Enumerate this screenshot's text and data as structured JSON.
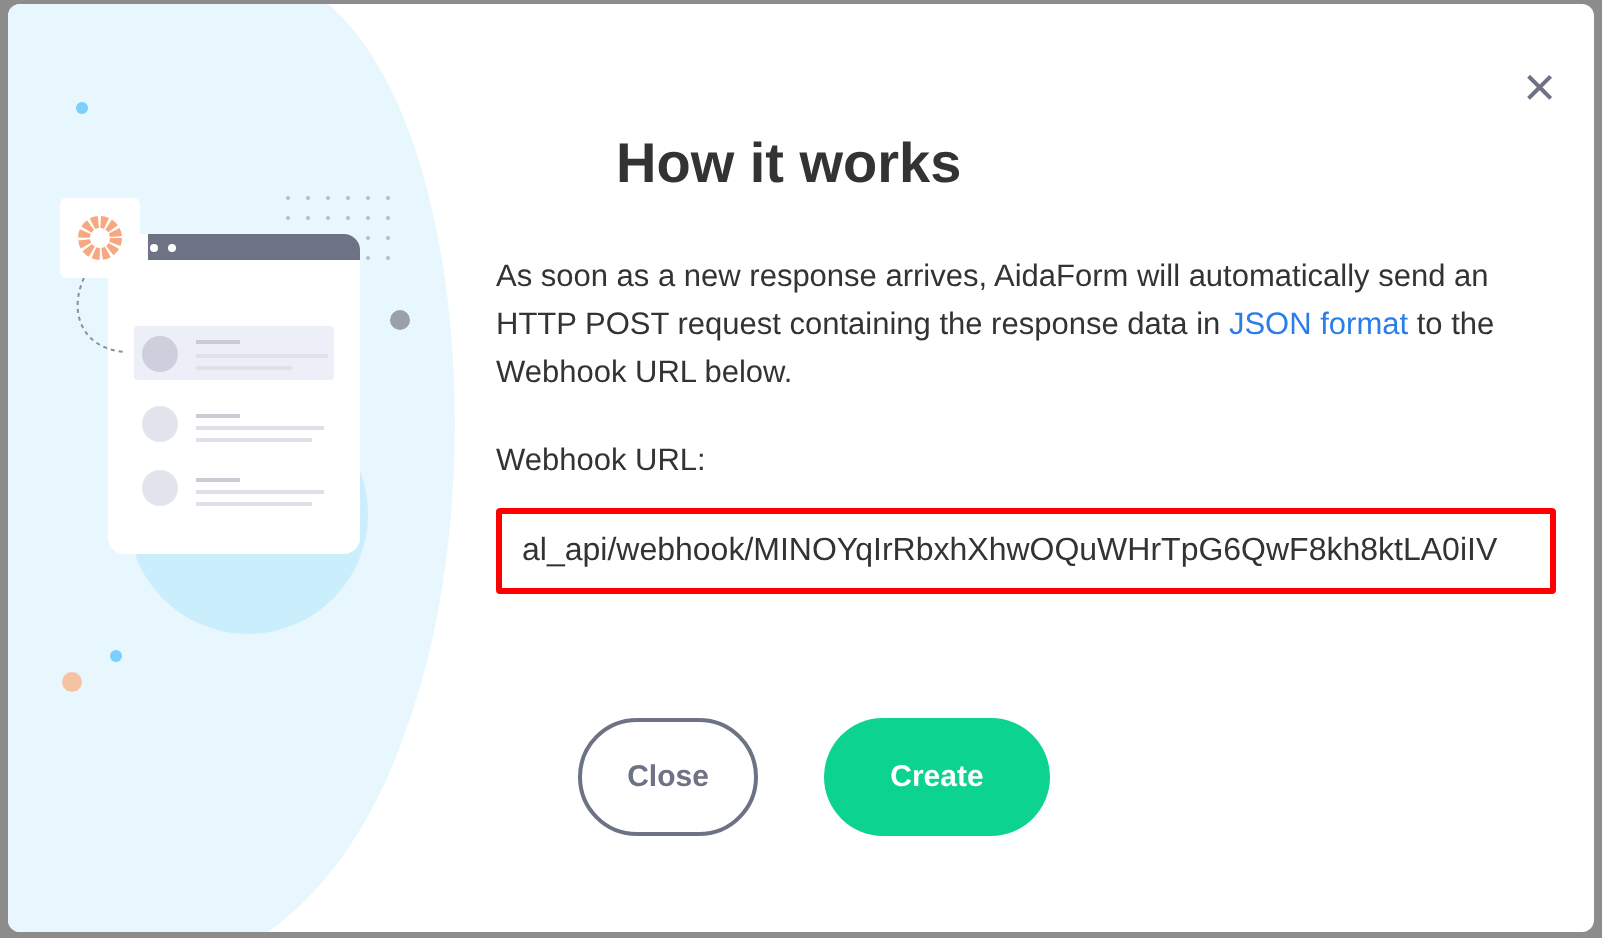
{
  "dialog": {
    "title": "How it works",
    "description": [
      "As soon as a new response arrives, AidaForm will automatically send an HTTP POST request containing the response data in ",
      "JSON format",
      " to the Webhook URL below."
    ],
    "close_icon": "×"
  },
  "field": {
    "label": "Webhook URL:",
    "value": "al_api/webhook/MINOYqIrRbxhXhwOQuWHrTpG6QwF8kh8ktLA0iIV",
    "highlighted": true
  },
  "buttons": [
    {
      "label": "Close",
      "kind": "secondary"
    },
    {
      "label": "Create",
      "kind": "primary"
    }
  ]
}
